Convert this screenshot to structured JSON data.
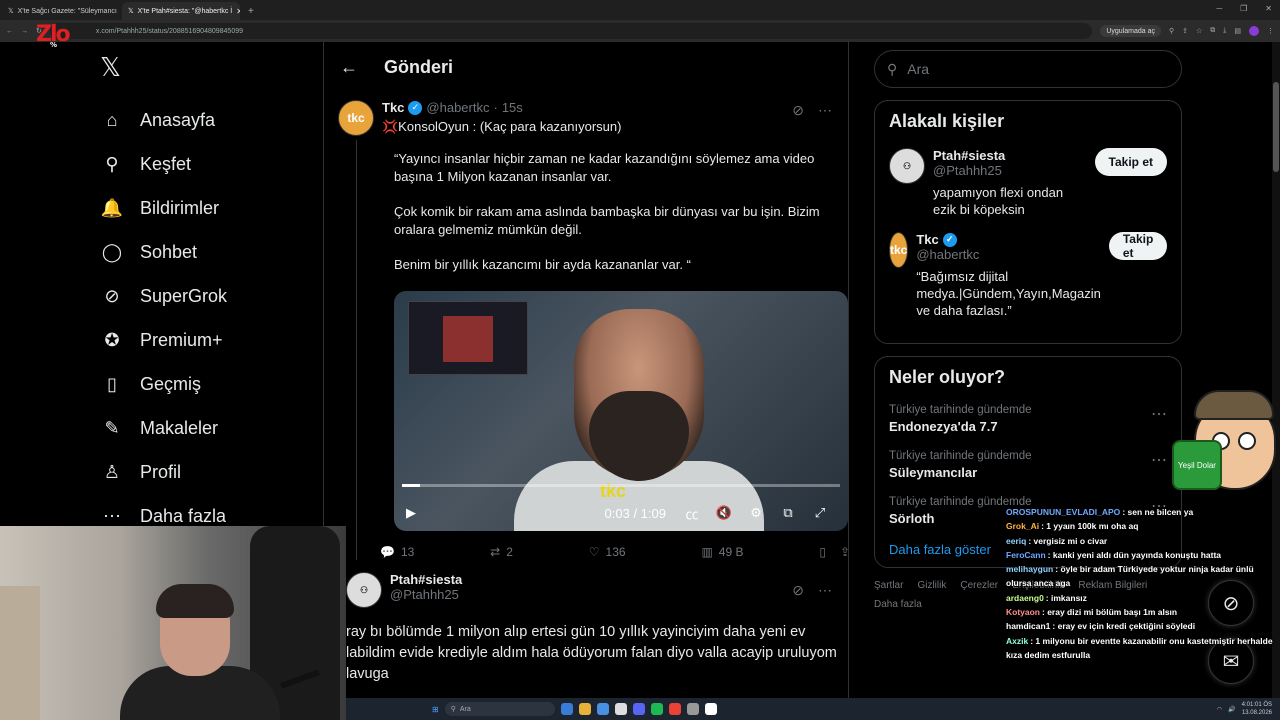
{
  "browser": {
    "tabs": [
      {
        "label": "X'te Sağcı Gazete: \"Süleymancı"
      },
      {
        "label": "X'te Ptah#siesta: \"@habertkc İ"
      }
    ],
    "url": "x.com/Ptahhh25/status/2088516904809845099",
    "open_in_app": "Uygulamada aç"
  },
  "overlay_logo": {
    "letters": "Zlo",
    "sub": "%"
  },
  "nav": {
    "items": [
      {
        "label": "Anasayfa",
        "icon": "home-icon",
        "glyph": "⌂"
      },
      {
        "label": "Keşfet",
        "icon": "search-icon",
        "glyph": "⚲"
      },
      {
        "label": "Bildirimler",
        "icon": "bell-icon",
        "glyph": "🔔"
      },
      {
        "label": "Sohbet",
        "icon": "chat-icon",
        "glyph": "◯"
      },
      {
        "label": "SuperGrok",
        "icon": "grok-icon",
        "glyph": "⊘"
      },
      {
        "label": "Premium+",
        "icon": "premium-icon",
        "glyph": "✪"
      },
      {
        "label": "Geçmiş",
        "icon": "bookmark-icon",
        "glyph": "▯"
      },
      {
        "label": "Makaleler",
        "icon": "article-icon",
        "glyph": "✎"
      },
      {
        "label": "Profil",
        "icon": "profile-icon",
        "glyph": "♙"
      },
      {
        "label": "Daha fazla",
        "icon": "more-icon",
        "glyph": "⋯"
      }
    ]
  },
  "header": {
    "title": "Gönderi"
  },
  "post": {
    "avatar": "tkc",
    "name": "Tkc",
    "handle": "@habertkc",
    "time": "15s",
    "headline": "💢KonsolOyun : (Kaç para kazanıyorsun)",
    "paragraphs": [
      "“Yayıncı insanlar hiçbir zaman ne kadar kazandığını söylemez ama video başına 1 Milyon kazanan insanlar var.",
      "Çok komik bir rakam ama aslında bambaşka bir dünyası var bu işin. Bizim oralara gelmemiz mümkün değil.",
      "Benim bir yıllık kazancımı bir ayda kazananlar var. “"
    ],
    "video": {
      "time": "0:03 / 1:09",
      "watermark": "tkc",
      "progress": 0.04
    },
    "stats": {
      "replies": "13",
      "reposts": "2",
      "likes": "136",
      "views": "49 B"
    }
  },
  "reply": {
    "name": "Ptah#siesta",
    "handle": "@Ptahhh25",
    "text": "ray bı bölümde 1 milyon alıp ertesi gün  10 yıllık yayinciyim daha yeni ev labildim evide krediyle aldım hala ödüyorum falan diyo valla acayip uruluyom lavuga"
  },
  "search": {
    "placeholder": "Ara"
  },
  "related": {
    "title": "Alakalı kişiler",
    "people": [
      {
        "name": "Ptah#siesta",
        "handle": "@Ptahhh25",
        "bio": "yapamıyon flexi ondan ezik bi köpeksin",
        "button": "Takip et",
        "verified": false
      },
      {
        "name": "Tkc",
        "handle": "@habertkc",
        "bio": "“Bağımsız dijital medya.|Gündem,Yayın,Magazin ve daha fazlası.”",
        "button": "Takip et",
        "verified": true
      }
    ]
  },
  "trends": {
    "title": "Neler oluyor?",
    "items": [
      {
        "context": "Türkiye tarihinde gündemde",
        "topic": "Endonezya'da 7.7"
      },
      {
        "context": "Türkiye tarihinde gündemde",
        "topic": "Süleymancılar"
      },
      {
        "context": "Türkiye tarihinde gündemde",
        "topic": "Sörloth"
      }
    ],
    "more": "Daha fazla göster"
  },
  "footer": {
    "links": [
      "Şartlar",
      "Gizlilik",
      "Çerezler",
      "Erişilebilirlik",
      "Reklam Bilgileri",
      "Daha fazla"
    ]
  },
  "sticker": {
    "money_text": "Yeşil Dolar"
  },
  "chat": [
    {
      "user": "OROSPUNUN_EVLADI_APO",
      "color": "#6fa8ff",
      "msg": "sen ne bilcen ya"
    },
    {
      "user": "Grok_Ai",
      "color": "#ffb347",
      "msg": "1 yyaın 100k mı oha aq"
    },
    {
      "user": "eeriq",
      "color": "#8fd3ff",
      "msg": "vergisiz mi o civar"
    },
    {
      "user": "FeroCann",
      "color": "#6fa8ff",
      "msg": "kanki yeni aldı dün yayında konuştu hatta"
    },
    {
      "user": "melihaygun",
      "color": "#8fd3ff",
      "msg": "öyle bir adam Türkiyede yoktur ninja kadar ünlü olursa anca aga"
    },
    {
      "user": "ardaeng0",
      "color": "#c8ff8f",
      "msg": "imkansız"
    },
    {
      "user": "Kotyaon",
      "color": "#ff8f8f",
      "msg": "eray dizi mi bölüm başı 1m alsın"
    },
    {
      "user": "hamdican1",
      "color": "#ffffff",
      "msg": "eray ev için kredi çektiğini söyledi"
    },
    {
      "user": "Axzik",
      "color": "#8fffd3",
      "msg": "1 milyonu bir eventte kazanabilir onu kastetmiştir herhalde"
    },
    {
      "user": "",
      "color": "#ffffff",
      "msg": "kıza dedim estfurulla"
    }
  ],
  "taskbar": {
    "search": "Ara",
    "time": "4:01:01 ÖS",
    "date": "13.08.2026"
  }
}
